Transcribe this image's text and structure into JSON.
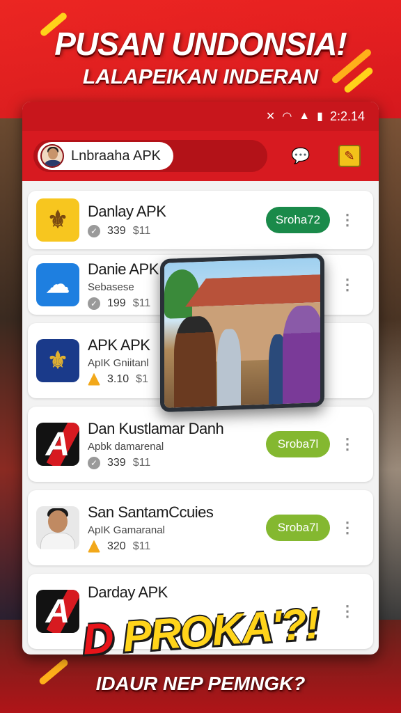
{
  "banner": {
    "headline": "PUSAN UNDONSIA!",
    "subheadline": "LALAPEIKAN INDERAN",
    "promo_prefix": "D",
    "promo_text": "PROKA'?!",
    "footer": "IDAUR  NEP PEMNGK?"
  },
  "statusbar": {
    "time": "2:2.14",
    "icons": [
      "no-sound-icon",
      "wifi-icon",
      "signal-icon",
      "battery-icon"
    ]
  },
  "appbar": {
    "search_label": "Lnbraaha APK",
    "chat_icon": "chat-bubble-icon",
    "edit_icon": "edit-icon"
  },
  "apps": [
    {
      "name": "Danlay APK",
      "subtitle": "",
      "rating": "339",
      "size": "$11",
      "button": "Sroha72",
      "icon": "garuda-yellow-icon"
    },
    {
      "name": "Danie APK",
      "subtitle": "Sebasese",
      "rating": "199",
      "size": "$11",
      "button": "",
      "icon": "cloud-icon"
    },
    {
      "name": "APK APK",
      "subtitle": "ApIK Gniitanl",
      "rating": "3.10",
      "size": "$1",
      "button": "",
      "icon": "garuda-blue-icon"
    },
    {
      "name": "Dan Kustlamar Danh",
      "subtitle": "Apbk damarenal",
      "rating": "339",
      "size": "$11",
      "button": "Sroba7l",
      "icon": "letter-a-icon"
    },
    {
      "name": "San SantamCcuies",
      "subtitle": "ApIK Gamaranal",
      "rating": "320",
      "size": "$11",
      "button": "Sroba7l",
      "icon": "person-photo-icon"
    },
    {
      "name": "Darday APK",
      "subtitle": "",
      "rating": "",
      "size": "",
      "button": "",
      "icon": "letter-a-icon"
    }
  ],
  "colors": {
    "brand_red": "#d71a20",
    "button_green": "#1a8a4a",
    "button_lime": "#84b830",
    "promo_yellow": "#ffd41a"
  }
}
